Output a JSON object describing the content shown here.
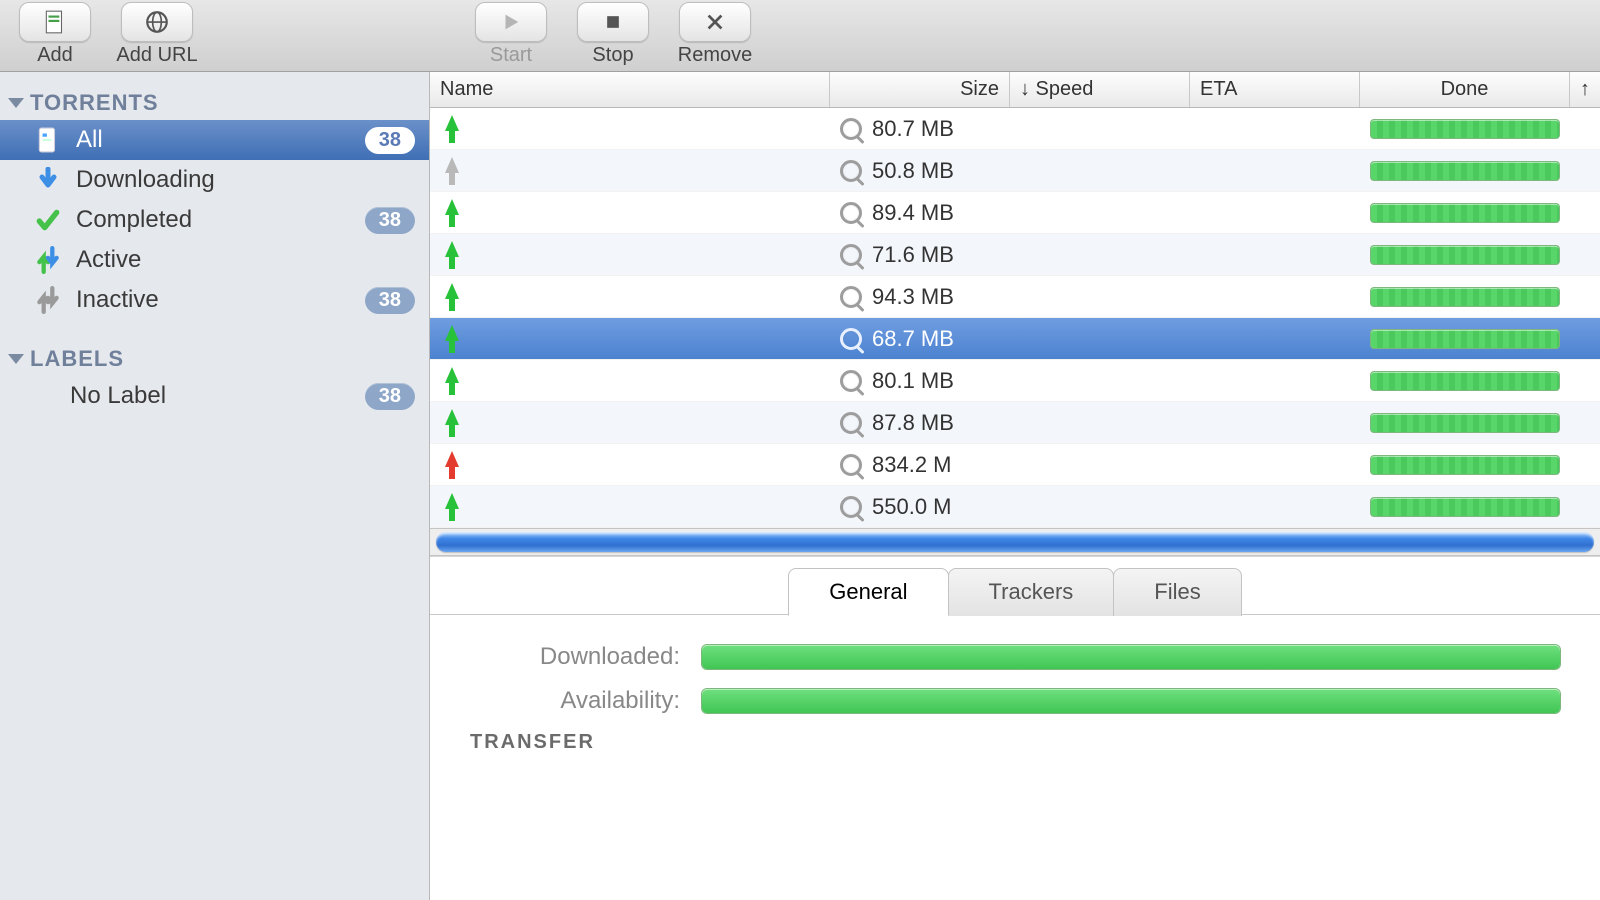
{
  "toolbar": {
    "add": "Add",
    "add_url": "Add URL",
    "start": "Start",
    "stop": "Stop",
    "remove": "Remove"
  },
  "sidebar": {
    "sections": {
      "torrents_header": "TORRENTS",
      "labels_header": "LABELS"
    },
    "items": [
      {
        "label": "All",
        "count": "38",
        "selected": true
      },
      {
        "label": "Downloading",
        "count": ""
      },
      {
        "label": "Completed",
        "count": "38"
      },
      {
        "label": "Active",
        "count": ""
      },
      {
        "label": "Inactive",
        "count": "38"
      }
    ],
    "labels": [
      {
        "label": "No Label",
        "count": "38"
      }
    ]
  },
  "columns": {
    "name": "Name",
    "size": "Size",
    "down_speed": "↓ Speed",
    "eta": "ETA",
    "done": "Done",
    "up_speed": "↑"
  },
  "rows": [
    {
      "status": "green",
      "size": "80.7 MB",
      "selected": false
    },
    {
      "status": "gray",
      "size": "50.8 MB",
      "selected": false
    },
    {
      "status": "green",
      "size": "89.4 MB",
      "selected": false
    },
    {
      "status": "green",
      "size": "71.6 MB",
      "selected": false
    },
    {
      "status": "green",
      "size": "94.3 MB",
      "selected": false
    },
    {
      "status": "green",
      "size": "68.7 MB",
      "selected": true
    },
    {
      "status": "green",
      "size": "80.1 MB",
      "selected": false
    },
    {
      "status": "green",
      "size": "87.8 MB",
      "selected": false
    },
    {
      "status": "red",
      "size": "834.2 M",
      "selected": false
    },
    {
      "status": "green",
      "size": "550.0 M",
      "selected": false
    }
  ],
  "tabs": {
    "general": "General",
    "trackers": "Trackers",
    "files": "Files"
  },
  "details": {
    "downloaded_label": "Downloaded:",
    "availability_label": "Availability:",
    "transfer_header": "TRANSFER"
  }
}
